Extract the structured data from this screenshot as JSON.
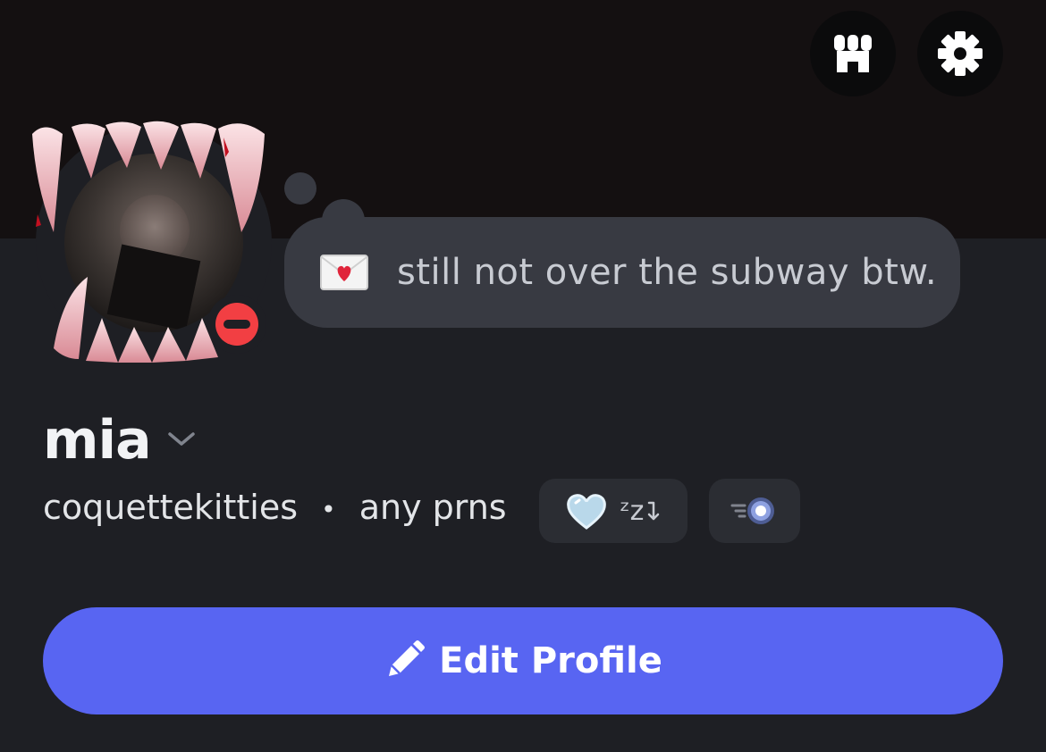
{
  "header": {
    "shop_icon": "shop-icon",
    "settings_icon": "gear-icon"
  },
  "profile": {
    "status": "dnd",
    "custom_status": {
      "emoji": "love-letter",
      "text": "still not over the subway btw."
    },
    "display_name": "mia",
    "username": "coquettekitties",
    "separator": "•",
    "pronouns": "any prns",
    "badges": [
      {
        "icon": "heart-gem-icon",
        "label": "ᶻz"
      },
      {
        "icon": "nitro-badge-icon"
      }
    ]
  },
  "actions": {
    "edit_label": "Edit Profile"
  },
  "colors": {
    "accent": "#5865f2",
    "background": "#1e1f24",
    "banner": "#141011",
    "bubble": "#383a42",
    "dnd": "#f23f43"
  }
}
